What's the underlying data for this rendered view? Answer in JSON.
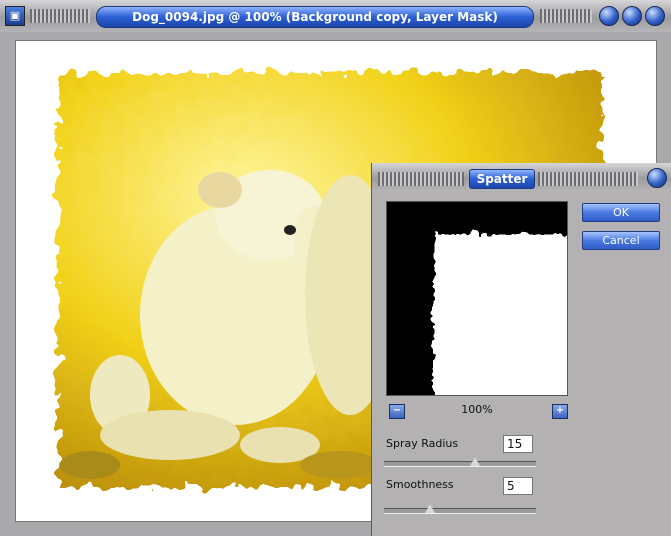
{
  "window": {
    "title": "Dog_0094.jpg @ 100% (Background copy, Layer Mask)",
    "icon": "photo-app-icon"
  },
  "dialog": {
    "title": "Spatter",
    "ok_label": "OK",
    "cancel_label": "Cancel",
    "zoom_level": "100%",
    "zoom_out_symbol": "−",
    "zoom_in_symbol": "+",
    "spray_radius": {
      "label": "Spray Radius",
      "value": "15",
      "slider_fraction": 0.6
    },
    "smoothness": {
      "label": "Smoothness",
      "value": "5",
      "slider_fraction": 0.3
    }
  },
  "colors": {
    "accent": "#2c5fd3",
    "chrome": "#a9a9ab"
  }
}
